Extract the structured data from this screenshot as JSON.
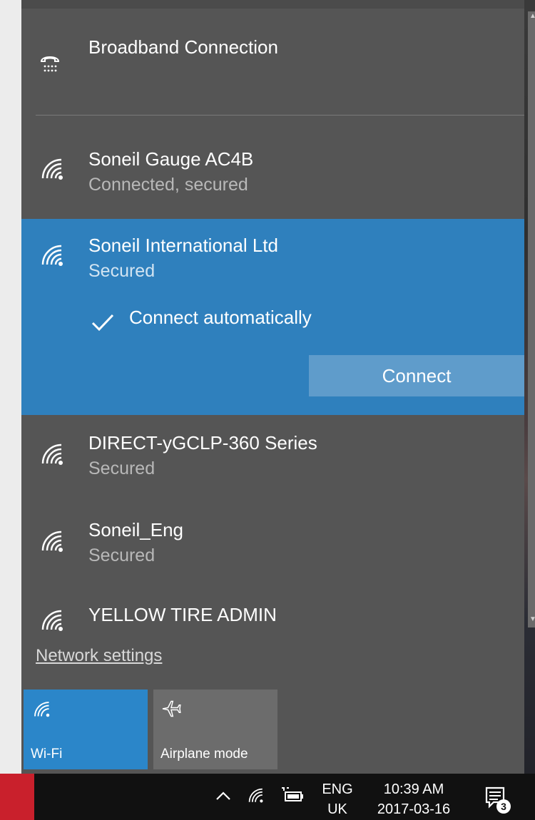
{
  "wired": {
    "name": "Broadband Connection"
  },
  "networks": [
    {
      "name": "Soneil Gauge AC4B",
      "status": "Connected, secured"
    },
    {
      "name": "Soneil International Ltd",
      "status": "Secured",
      "connect_automatically_label": "Connect automatically",
      "connect_automatically_checked": true,
      "connect_button": "Connect"
    },
    {
      "name": "DIRECT-yGCLP-360 Series",
      "status": "Secured"
    },
    {
      "name": "Soneil_Eng",
      "status": "Secured"
    },
    {
      "name": "YELLOW TIRE ADMIN"
    }
  ],
  "network_settings_link": "Network settings",
  "quick_actions": [
    {
      "label": "Wi-Fi",
      "icon": "wifi-icon",
      "active": true
    },
    {
      "label": "Airplane mode",
      "icon": "airplane-icon",
      "active": false
    }
  ],
  "taskbar": {
    "language": {
      "line1": "ENG",
      "line2": "UK"
    },
    "time": "10:39 AM",
    "date": "2017-03-16",
    "notification_count": "3"
  },
  "colors": {
    "panel_bg": "#555555",
    "selected_bg": "#2f80bd",
    "connect_button_bg": "#5f9ccb",
    "wifi_tile_bg": "#2b86c9",
    "airplane_tile_bg": "#6c6c6c",
    "taskbar_bg": "#111111"
  }
}
